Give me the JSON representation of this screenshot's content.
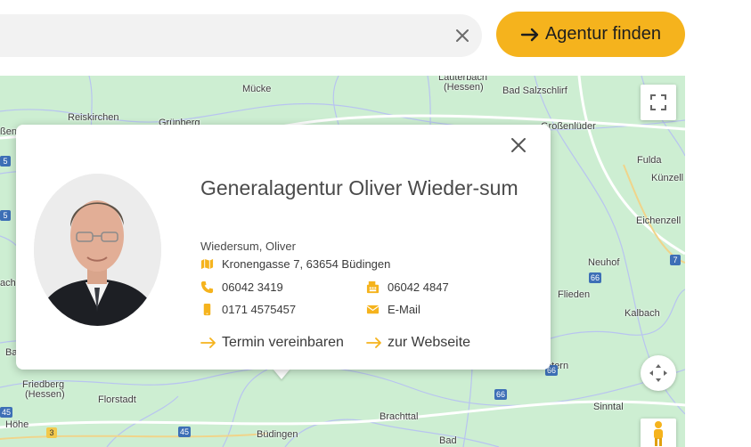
{
  "search": {
    "placeholder": ""
  },
  "find_button": {
    "label": "Agentur finden"
  },
  "map": {
    "labels": [
      {
        "text": "Mücke"
      },
      {
        "text": "Lauterbach"
      },
      {
        "text": "(Hessen)"
      },
      {
        "text": "Bad Salzschlirf"
      },
      {
        "text": "Reiskirchen"
      },
      {
        "text": "Grünberg"
      },
      {
        "text": "ßen"
      },
      {
        "text": "Großenlüder"
      },
      {
        "text": "Fulda"
      },
      {
        "text": "Künzell"
      },
      {
        "text": "Eichenzell"
      },
      {
        "text": "Neuhof"
      },
      {
        "text": "Flieden"
      },
      {
        "text": "Kalbach"
      },
      {
        "text": "Schlüchtern"
      },
      {
        "text": "Friedberg"
      },
      {
        "text": "(Hessen)"
      },
      {
        "text": "Florstadt"
      },
      {
        "text": "Büdingen"
      },
      {
        "text": "Brachttal"
      },
      {
        "text": "Sinntal"
      },
      {
        "text": "Bad"
      },
      {
        "text": "Höhe"
      },
      {
        "text": "ach"
      },
      {
        "text": "Ba"
      }
    ],
    "shields": [
      "5",
      "5",
      "66",
      "7",
      "66",
      "45",
      "3",
      "45",
      "66"
    ]
  },
  "agency": {
    "title": "Generalagentur Oliver Wieder-sum",
    "owner": "Wiedersum, Oliver",
    "address": "Kronengasse 7, 63654 Büdingen",
    "phone": "06042 3419",
    "fax": "06042 4847",
    "mobile": "0171 4575457",
    "email": "E-Mail",
    "appointment": "Termin vereinbaren",
    "website": "zur Webseite"
  },
  "colors": {
    "accent": "#f5b31d",
    "map_bg": "#cdeed2",
    "road": "#b8c4f0",
    "text": "#4a4a4a"
  },
  "icons": [
    "close-icon",
    "arrow-right-icon",
    "fullscreen-icon",
    "map-address-icon",
    "phone-icon",
    "fax-icon",
    "mobile-icon",
    "mail-icon",
    "navigation-icon",
    "pegman-icon"
  ]
}
